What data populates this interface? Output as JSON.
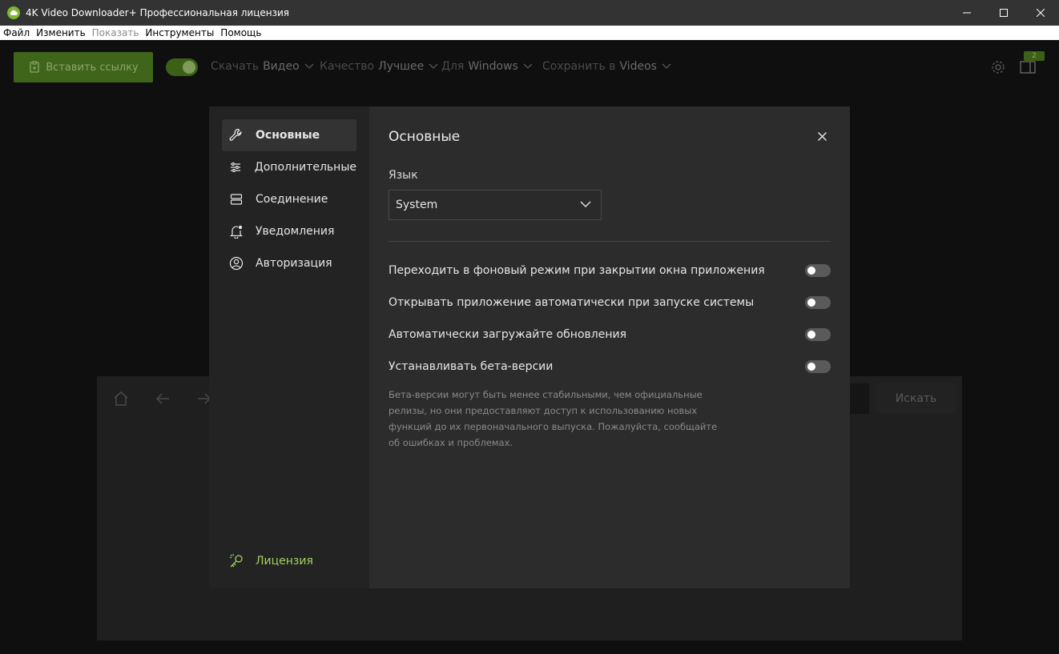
{
  "window": {
    "title": "4K Video Downloader+ Профессиональная лицензия",
    "icons": {
      "app": "app-cloud-icon",
      "minimize": "minimize-icon",
      "maximize": "maximize-icon",
      "close": "close-icon"
    }
  },
  "menu": [
    {
      "label": "Файл",
      "enabled": true
    },
    {
      "label": "Изменить",
      "enabled": true
    },
    {
      "label": "Показать",
      "enabled": false
    },
    {
      "label": "Инструменты",
      "enabled": true
    },
    {
      "label": "Помощь",
      "enabled": true
    }
  ],
  "toolbar": {
    "paste_label": "Вставить ссылку",
    "smart_mode_on": true,
    "download": {
      "label": "Скачать",
      "value": "Видео"
    },
    "quality": {
      "label": "Качество",
      "value": "Лучшее"
    },
    "for": {
      "label": "Для",
      "value": "Windows"
    },
    "save": {
      "label": "Сохранить в",
      "value": "Videos"
    },
    "badge_count": "2"
  },
  "browser": {
    "search_label": "Искать"
  },
  "settings": {
    "title": "Основные",
    "nav": [
      {
        "label": "Основные",
        "icon": "wrench-icon",
        "active": true
      },
      {
        "label": "Дополнительные",
        "icon": "sliders-icon",
        "active": false
      },
      {
        "label": "Соединение",
        "icon": "server-icon",
        "active": false
      },
      {
        "label": "Уведомления",
        "icon": "bell-icon",
        "active": false
      },
      {
        "label": "Авторизация",
        "icon": "user-circle-icon",
        "active": false
      }
    ],
    "license_label": "Лицензия",
    "language_label": "Язык",
    "language_value": "System",
    "options": [
      {
        "label": "Переходить в фоновый режим при закрытии окна приложения",
        "enabled": false
      },
      {
        "label": "Открывать приложение автоматически при запуске системы",
        "enabled": false
      },
      {
        "label": "Автоматически загружайте обновления",
        "enabled": false
      },
      {
        "label": "Устанавливать бета-версии",
        "enabled": false
      }
    ],
    "beta_hint": "Бета-версии могут быть менее стабильными, чем официальные релизы, но они предоставляют доступ к использованию новых функций до их первоначального выпуска. Пожалуйста, сообщайте об ошибках и проблемах."
  }
}
